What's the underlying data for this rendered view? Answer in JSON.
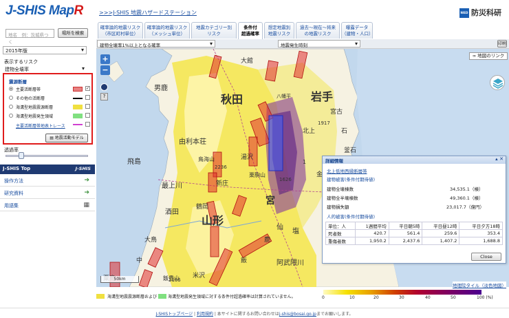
{
  "header": {
    "logo": "J-SHIS Map",
    "logo_r": "R",
    "breadcrumb": ">>>J-SHIS 地震ハザードステーション",
    "org": "防災科研",
    "org_mark": "NIED"
  },
  "left": {
    "search_placeholder": "地名　例：茨城県つく",
    "search_button": "場所を検索",
    "year_select": "2015年版",
    "risk_label": "表示するリスク",
    "risk_select": "建物全壊率",
    "fault_box": {
      "title": "震源断層",
      "rows": [
        {
          "label": "主要活断層帯",
          "swatch": "#e88080",
          "checked": true,
          "selected": true
        },
        {
          "label": "その他の活断層",
          "swatch": "#000000",
          "checked": false,
          "selected": false
        },
        {
          "label": "海溝型地震震源断層",
          "swatch": "#f0e040",
          "checked": false,
          "selected": false
        },
        {
          "label": "海溝型地震発生領域",
          "swatch": "#80e080",
          "checked": false,
          "selected": false
        }
      ],
      "link": "主要活断層帯地表トレース",
      "link_swatch": "#d040d0",
      "model_button": "地震活動モデル"
    },
    "opacity_label": "透過率",
    "opacity_level": 0.2,
    "jtop": "J-SHIS Top",
    "jtop_logo": "J-SHIS",
    "menu": [
      "操作方法",
      "研究資料",
      "用語集"
    ]
  },
  "tabs": [
    {
      "label1": "確率論的地震リスク",
      "label2": "（市区町村単位）"
    },
    {
      "label1": "確率論的地震リスク",
      "label2": "（メッシュ単位）"
    },
    {
      "label1": "地震カテゴリー別",
      "label2": "リスク"
    },
    {
      "label1": "条件付",
      "label2": "超過確率",
      "active": true
    },
    {
      "label1": "想定地震別",
      "label2": "地震リスク"
    },
    {
      "label1": "過去〜現在〜将来",
      "label2": "の地震リスク"
    },
    {
      "label1": "曝露データ",
      "label2": "（建物・人口）"
    }
  ],
  "toolbar": {
    "prob_select": "建物全壊率1%以上となる確率",
    "time_select": "地震発生時刻",
    "print_button": "印刷",
    "map_link_button": "地図のリンク"
  },
  "map": {
    "zoom_in": "+",
    "zoom_out": "−",
    "labels": [
      {
        "text": "秋田"
      },
      {
        "text": "岩手"
      },
      {
        "text": "山形"
      },
      {
        "text": "宮"
      },
      {
        "text": "八幡平"
      },
      {
        "text": "宮古"
      },
      {
        "text": "由利本荘"
      },
      {
        "text": "釜石"
      },
      {
        "text": "鳥海山"
      },
      {
        "text": "最上川"
      },
      {
        "text": "酒田"
      },
      {
        "text": "新庄"
      },
      {
        "text": "飛島"
      },
      {
        "text": "鶴岡"
      },
      {
        "text": "栗駒山"
      },
      {
        "text": "米沢"
      },
      {
        "text": "飯豊山"
      },
      {
        "text": "阿武隈川"
      },
      {
        "text": "男鹿"
      },
      {
        "text": "大鳥"
      },
      {
        "text": "北上"
      },
      {
        "text": "大館"
      },
      {
        "text": "粟島"
      },
      {
        "text": "湯沢"
      },
      {
        "text": "1917"
      },
      {
        "text": "2105"
      },
      {
        "text": "2236"
      },
      {
        "text": "1626"
      },
      {
        "text": "金"
      },
      {
        "text": "石"
      },
      {
        "text": "仙"
      },
      {
        "text": "塩"
      },
      {
        "text": "鹿"
      },
      {
        "text": "飯"
      },
      {
        "text": "中"
      },
      {
        "text": "1"
      }
    ],
    "scale_label": "50km",
    "tile_credit": "地理院タイル（淡色地図）"
  },
  "legend": {
    "note_yellow": "海溝型地震震源断層および",
    "note_green": "海溝型地震発生領域に対する条件付超過確率は計算されていません。",
    "yellow": "#f0e040",
    "green": "#80e080",
    "ticks": [
      "0",
      "10",
      "20",
      "30",
      "40",
      "50",
      "100 (%)"
    ],
    "colors": [
      "#fffbc0",
      "#f5e000",
      "#e8a000",
      "#d04000",
      "#b00030",
      "#800060",
      "#4a0090"
    ]
  },
  "detail": {
    "title": "詳細情報",
    "fault_link": "北上低地西縁断層帯",
    "bldg_header": "建物被害(条件付期待値)",
    "bldg_rows": [
      {
        "label": "建物全壊棟数",
        "value": "34,535.1（棟）"
      },
      {
        "label": "建物全半壊棟数",
        "value": "49,360.1（棟）"
      },
      {
        "label": "建物損失額",
        "value": "23,017.7（億円）"
      }
    ],
    "human_header": "人的被害(条件付期待値)",
    "cols": [
      "単位：人",
      "1週間平均",
      "平日朝5時",
      "平日昼12時",
      "平日夕方18時"
    ],
    "rows": [
      {
        "label": "死者数",
        "values": [
          "420.7",
          "561.4",
          "259.6",
          "353.4"
        ]
      },
      {
        "label": "重傷者数",
        "values": [
          "1,950.2",
          "2,437.6",
          "1,407.2",
          "1,688.8"
        ]
      }
    ],
    "close": "Close"
  },
  "footer": {
    "top_link": "J-SHISトップページ",
    "terms": "利用規約",
    "text1": "本サイトに関するお問い合わせは",
    "email": "j-shis@bosai.go.jp",
    "text2": "までお願いします。"
  }
}
